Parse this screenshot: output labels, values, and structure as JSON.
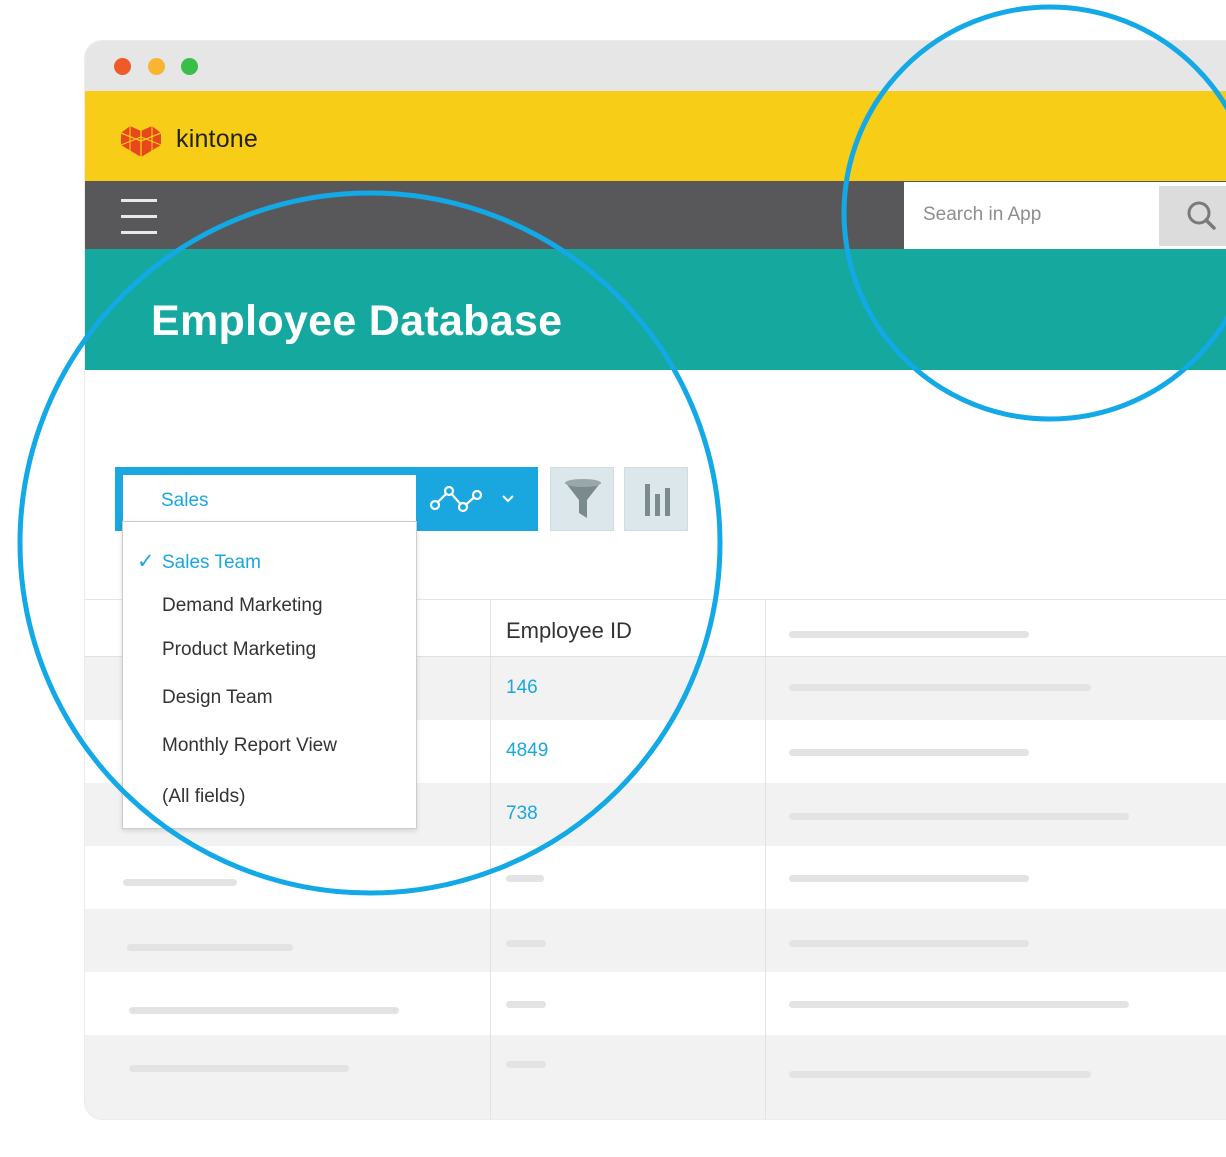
{
  "window": {
    "controls": [
      {
        "name": "close",
        "color": "#f05a28"
      },
      {
        "name": "minimize",
        "color": "#f7b531"
      },
      {
        "name": "maximize",
        "color": "#3bbd4a"
      }
    ]
  },
  "brand": {
    "logo_text": "kintone",
    "color": "#f7cd17",
    "logo_icon": "kintone-hexagon-logo"
  },
  "nav": {
    "menu_icon": "hamburger-menu-icon",
    "search_placeholder": "Search in App",
    "search_icon": "magnifier-icon"
  },
  "app": {
    "title": "Employee Database",
    "color": "#14a89e"
  },
  "toolbar": {
    "selected_view": "Sales",
    "graph_icon": "line-graph-icon",
    "dropdown_icon": "chevron-down-icon",
    "filter_icon": "funnel-icon",
    "chart_icon": "bar-chart-icon",
    "accent": "#1aa7e0"
  },
  "view_menu": {
    "check_mark": "✓",
    "items": [
      {
        "label": "Sales Team",
        "selected": true
      },
      {
        "label": "Demand Marketing",
        "selected": false
      },
      {
        "label": "Product Marketing",
        "selected": false
      },
      {
        "label": "Design Team",
        "selected": false
      },
      {
        "label": "Monthly Report View",
        "selected": false
      },
      {
        "label": "(All fields)",
        "selected": false
      }
    ]
  },
  "table": {
    "columns": [
      "Employee ID"
    ],
    "rows": [
      {
        "employee_id": "146"
      },
      {
        "employee_id": "4849"
      },
      {
        "employee_id": "738"
      }
    ]
  },
  "highlight_color": "#12a9e6"
}
